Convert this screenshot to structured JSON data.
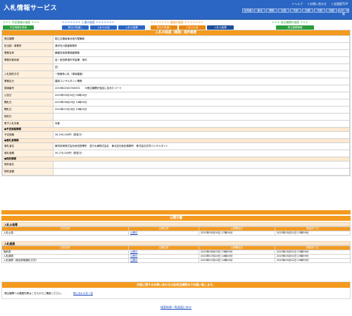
{
  "header": {
    "logo": "入札情報サービス",
    "links": [
      "＋ヘルプ",
      "＋お問い合わせ",
      "＋全国版TOP"
    ],
    "regions": [
      "北海道",
      "東北",
      "関東",
      "北陸",
      "中部",
      "近畿",
      "中国",
      "四国",
      "九州・沖縄"
    ]
  },
  "nav": {
    "g1_title": "＊＊＊ 予定情報の検索 ＊＊＊",
    "g1_buttons": [
      "予定情報を検索"
    ],
    "g2_title": "＊＊＊＊＊＊＊ 工事の検索 ＊＊＊＊＊＊＊",
    "g2_buttons": [
      "発注の見通し",
      "入札の公告",
      "入札の結果"
    ],
    "g3_title": "＊＊＊＊＊＊＊ 業務の検索 ＊＊＊＊＊＊＊",
    "g3_buttons": [
      "発注の見通し",
      "入札の公告",
      "入札の結果"
    ],
    "g4_title": "＊＊＊ 発注機関の検索 ＊＊＊",
    "g4_buttons": [
      "発注機関情報"
    ]
  },
  "detail": {
    "title": "入札の経過（業務）案件概要",
    "rows": [
      {
        "label": "発注機関",
        "value": "国土交通省東北地方整備局"
      },
      {
        "label": "担当部・事務所",
        "value": "湯沢河川国道事務所"
      },
      {
        "label": "業務名称",
        "value": "横堀改良事業調査業務"
      },
      {
        "label": "業務対象地域",
        "value": "自）秋田県湯沢市皆瀬　地内"
      },
      {
        "label": "",
        "value": "至）"
      },
      {
        "label": "入札契約方式",
        "value": "一般競争入札（事後審査）"
      },
      {
        "label": "業務区分",
        "value": "建設コンサルタント業務"
      },
      {
        "label": "調達番号",
        "value": "2023B04302300001　　※発注機関が独自に定めたコード"
      },
      {
        "label": "公告日",
        "value": "2023年05月30日 00時00分"
      },
      {
        "label": "開札日",
        "value": "2023年06月29日 14時00分"
      },
      {
        "label": "開札日",
        "value": "2023年07月18日 10時00分"
      },
      {
        "label": "契約日",
        "value": ""
      },
      {
        "label": "電子入札対象",
        "value": "対象"
      }
    ],
    "price_section": "●予定価格情報",
    "price_rows": [
      {
        "label": "予定価格",
        "value": "36,190,000円（税抜き）"
      }
    ],
    "winner_section": "●落札者情報",
    "winner_rows": [
      {
        "label": "落札者名",
        "value": "東邦技術株式会社秋田営業所　並行大東株式会社　東北支社秋田事務所　株式会社共同コンサルタント"
      },
      {
        "label": "落札価格",
        "value": "30,770,000円（税抜き）"
      }
    ],
    "contract_section": "●契約情報",
    "contract_rows": [
      {
        "label": "契約者名",
        "value": ""
      },
      {
        "label": "契約金額",
        "value": ""
      }
    ]
  },
  "docs": {
    "title": "公開文書",
    "sec1": "入札公告等",
    "sec2": "入札経過",
    "headers": [
      "文書名称",
      "公開文書",
      "公開開始日",
      "閲覧終了日"
    ],
    "group1": [
      {
        "name": "入札公告",
        "link": "公開中",
        "start": "2023年05月30日 17時00分",
        "end": "2023年05月31日 23時59分"
      }
    ],
    "group2": [
      {
        "name": "契約書",
        "link": "公開中",
        "start": "2023年06月03日 23時59分",
        "end": "2023年05月31日 23時59分"
      },
      {
        "name": "入札調書",
        "link": "公開中",
        "start": "2023年07月20日 14時00分",
        "end": "2023年05月31日 23時59分"
      },
      {
        "name": "入札調書（総合評価落札方式）",
        "link": "公開中",
        "start": "2023年07月03日 14時00分",
        "end": "2023年05月31日 23時59分"
      }
    ]
  },
  "notice": {
    "title": "内容に関するお問い合わせは各発注機関までお願い致します。",
    "text": "発注機関への連絡先等はこちらからご確認ください。",
    "link": "問い合わせ先一覧"
  },
  "back_link": "検索結果一覧画面に戻る"
}
